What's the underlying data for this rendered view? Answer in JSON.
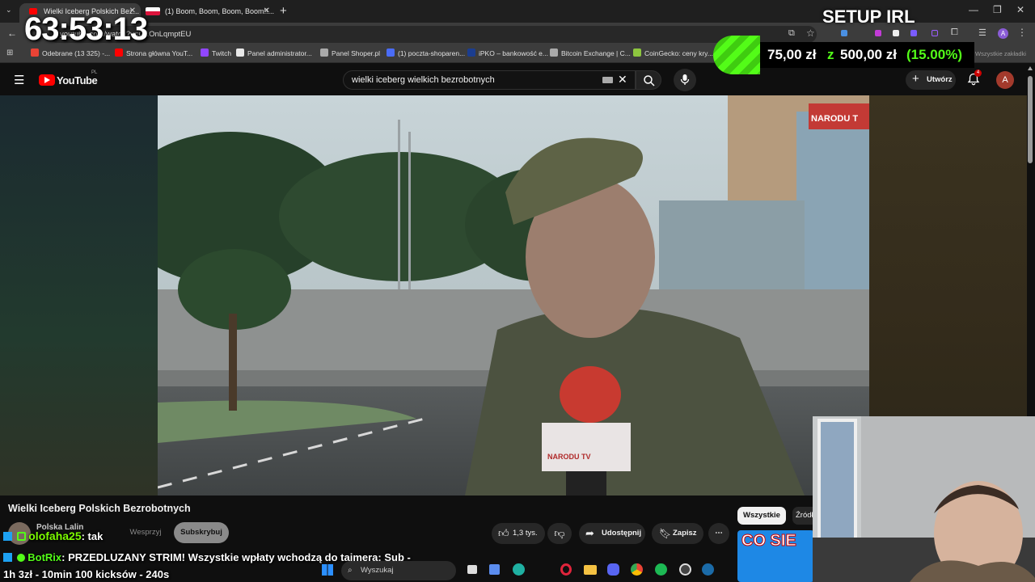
{
  "browser": {
    "tabs": [
      {
        "label": "Wielki Iceberg Polskich Bez...",
        "active": true
      },
      {
        "label": "(1) Boom, Boom, Boom, Boom!!...",
        "active": false
      }
    ],
    "url": "youtube.com/watch?v=G1OnLqmptEU",
    "bookmarks": [
      {
        "label": "Odebrane (13 325) -...",
        "color": "#ea4335"
      },
      {
        "label": "Strona główna YouT...",
        "color": "#ff0000"
      },
      {
        "label": "Twitch",
        "color": "#9146ff"
      },
      {
        "label": "Panel administrator...",
        "color": "#e8e8e8"
      },
      {
        "label": "Panel Shoper.pl",
        "color": "#aaaaaa"
      },
      {
        "label": "(1) poczta-shoparen...",
        "color": "#4a6cf7"
      },
      {
        "label": "iPKO – bankowość e...",
        "color": "#1b3d8f"
      },
      {
        "label": "Bitcoin Exchange | C...",
        "color": "#aaaaaa"
      },
      {
        "label": "CoinGecko: ceny kry...",
        "color": "#8dc63f"
      }
    ],
    "all_bookmarks": "Wszystkie zakładki"
  },
  "youtube": {
    "logo": "YouTube",
    "logo_region": "PL",
    "search_value": "wielki iceberg wielkich bezrobotnych",
    "create_label": "Utwórz",
    "notif_count": "4",
    "avatar_letter": "A",
    "video_title": "Wielki Iceberg Polskich Bezrobotnych",
    "channel_name": "Polska Lalin",
    "support_label": "Wesprzyj",
    "subscribe_label": "Subskrybuj",
    "like_count": "1,3 tys.",
    "share_label": "Udostępnij",
    "save_label": "Zapisz",
    "chip_all": "Wszystkie",
    "chip_sources": "Źródł",
    "thumb_text": "CO SIE",
    "video_banner": "NARODU T",
    "mic_label": "NARODU TV"
  },
  "overlay": {
    "timer": "63:53:13",
    "setup": "SETUP IRL",
    "donation": {
      "current": "75,00 zł",
      "separator": "z",
      "goal": "500,00 zł",
      "percent": "(15.00%)",
      "percent_value": 15
    }
  },
  "chat": [
    {
      "user": "olofaha25",
      "message": ": tak",
      "color": "#7cfc00"
    },
    {
      "user": "BotRix",
      "message": ": PRZEDLUZANY STRIM! Wszystkie wpłaty wchodzą do tajmera: Sub -",
      "color": "#53fc18"
    },
    {
      "user": "",
      "message": "1h 3zł - 10min 100 kicksów - 240s",
      "color": "#ffffff"
    }
  ],
  "taskbar": {
    "search_placeholder": "Wyszukaj"
  },
  "colors": {
    "accent_green": "#53fc18",
    "youtube_red": "#ff0000"
  }
}
